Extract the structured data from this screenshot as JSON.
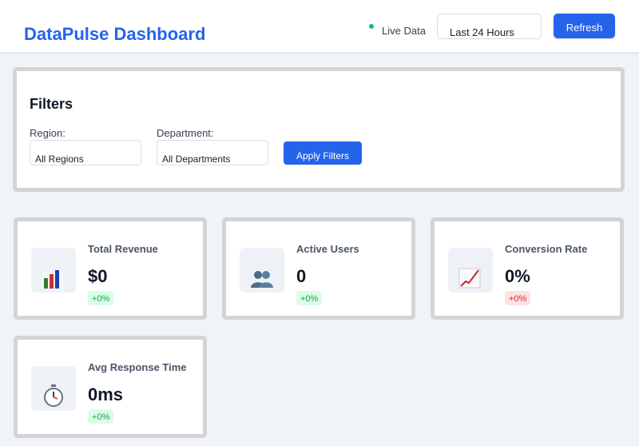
{
  "header": {
    "title": "DataPulse Dashboard",
    "live_label": "Live Data",
    "time_range": "Last 24 Hours",
    "refresh_label": "Refresh"
  },
  "filters": {
    "title": "Filters",
    "region_label": "Region:",
    "region_value": "All Regions",
    "department_label": "Department:",
    "department_value": "All Departments",
    "apply_label": "Apply Filters"
  },
  "metrics": [
    {
      "title": "Total Revenue",
      "value": "$0",
      "change": "+0%",
      "trend": "positive",
      "icon": "bar-chart-icon"
    },
    {
      "title": "Active Users",
      "value": "0",
      "change": "+0%",
      "trend": "positive",
      "icon": "users-icon"
    },
    {
      "title": "Conversion Rate",
      "value": "0%",
      "change": "+0%",
      "trend": "negative",
      "icon": "line-chart-icon"
    },
    {
      "title": "Avg Response Time",
      "value": "0ms",
      "change": "+0%",
      "trend": "positive",
      "icon": "stopwatch-icon"
    }
  ],
  "colors": {
    "accent": "#2563eb",
    "live": "#10b981",
    "positive_bg": "#dcfce7",
    "positive_text": "#16a34a",
    "negative_bg": "#fee2e2",
    "negative_text": "#dc2626"
  }
}
